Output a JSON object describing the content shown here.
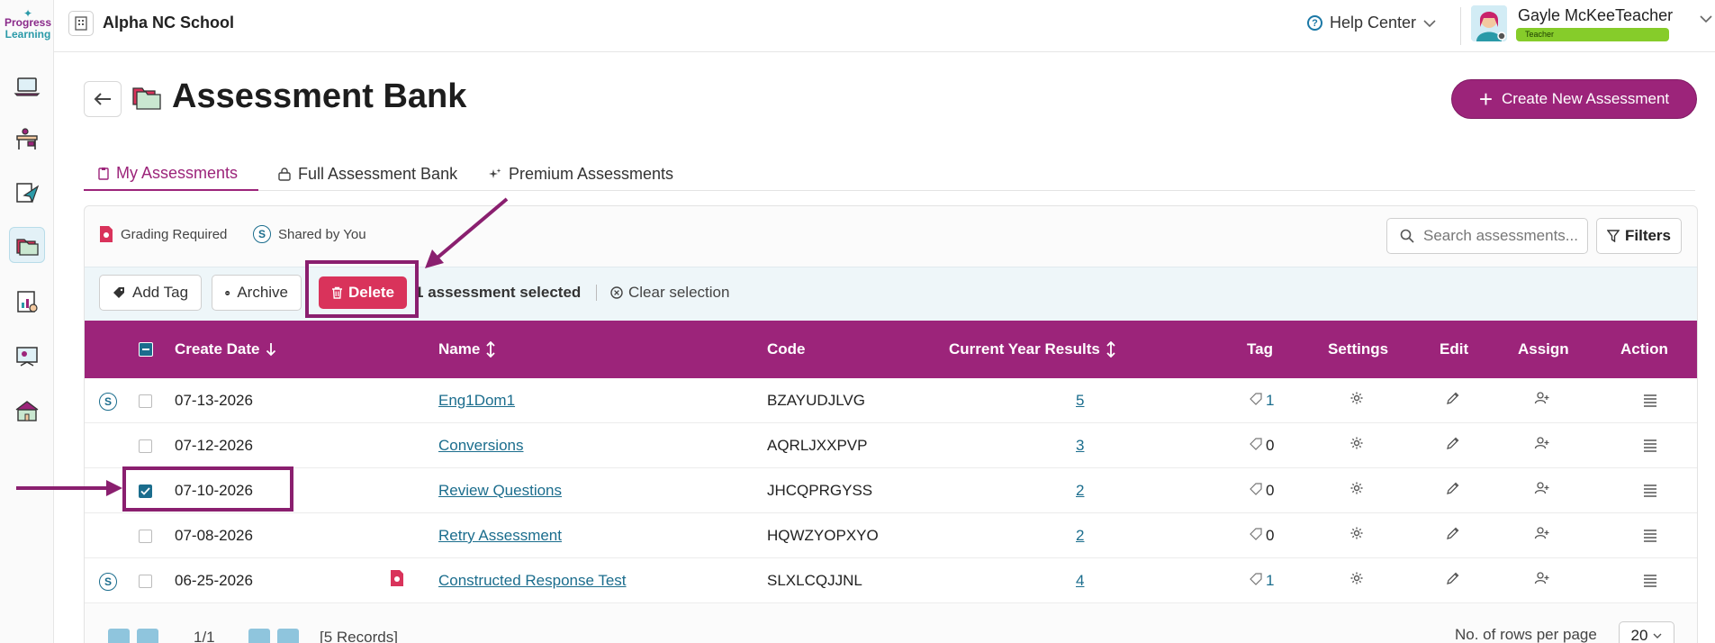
{
  "brand": {
    "logo_line1": "Progress",
    "logo_line2": "Learning"
  },
  "header": {
    "school_name": "Alpha NC School",
    "help_label": "Help Center",
    "user_name": "Gayle McKeeTeacher",
    "user_role": "Teacher"
  },
  "page": {
    "title": "Assessment Bank",
    "create_label": "Create New Assessment"
  },
  "tabs": [
    {
      "label": "My Assessments",
      "active": true
    },
    {
      "label": "Full Assessment Bank",
      "active": false
    },
    {
      "label": "Premium Assessments",
      "active": false
    }
  ],
  "legend": {
    "grading_required": "Grading Required",
    "shared_by_you": "Shared by You",
    "shared_badge": "S"
  },
  "search": {
    "placeholder": "Search assessments..."
  },
  "filters_label": "Filters",
  "bulk_actions": {
    "add_tag": "Add Tag",
    "archive": "Archive",
    "delete": "Delete",
    "selected_count": "1",
    "selected_text": "assessment selected",
    "clear": "Clear selection"
  },
  "table": {
    "columns": [
      "Create Date",
      "Name",
      "Code",
      "Current Year Results",
      "Tag",
      "Settings",
      "Edit",
      "Assign",
      "Action"
    ],
    "rows": [
      {
        "date": "07-13-2026",
        "name": "Eng1Dom1",
        "code": "BZAYUDJLVG",
        "results": "5",
        "tag": "1",
        "shared": true,
        "grading": false,
        "checked": false
      },
      {
        "date": "07-12-2026",
        "name": "Conversions",
        "code": "AQRLJXXPVP",
        "results": "3",
        "tag": "0",
        "shared": false,
        "grading": false,
        "checked": false
      },
      {
        "date": "07-10-2026",
        "name": "Review Questions",
        "code": "JHCQPRGYSS",
        "results": "2",
        "tag": "0",
        "shared": false,
        "grading": false,
        "checked": true
      },
      {
        "date": "07-08-2026",
        "name": "Retry Assessment",
        "code": "HQWZYOPXYO",
        "results": "2",
        "tag": "0",
        "shared": false,
        "grading": false,
        "checked": false
      },
      {
        "date": "06-25-2026",
        "name": "Constructed Response Test",
        "code": "SLXLCQJJNL",
        "results": "4",
        "tag": "1",
        "shared": true,
        "grading": true,
        "checked": false
      }
    ]
  },
  "pagination": {
    "page": "1/1",
    "records": "[5 Records]",
    "rows_label": "No. of rows per page",
    "rows_value": "20"
  },
  "colors": {
    "brand_purple": "#9c247a",
    "teal": "#1b6d8d",
    "delete_red": "#d9335b",
    "annotation": "#8a1f6f"
  }
}
